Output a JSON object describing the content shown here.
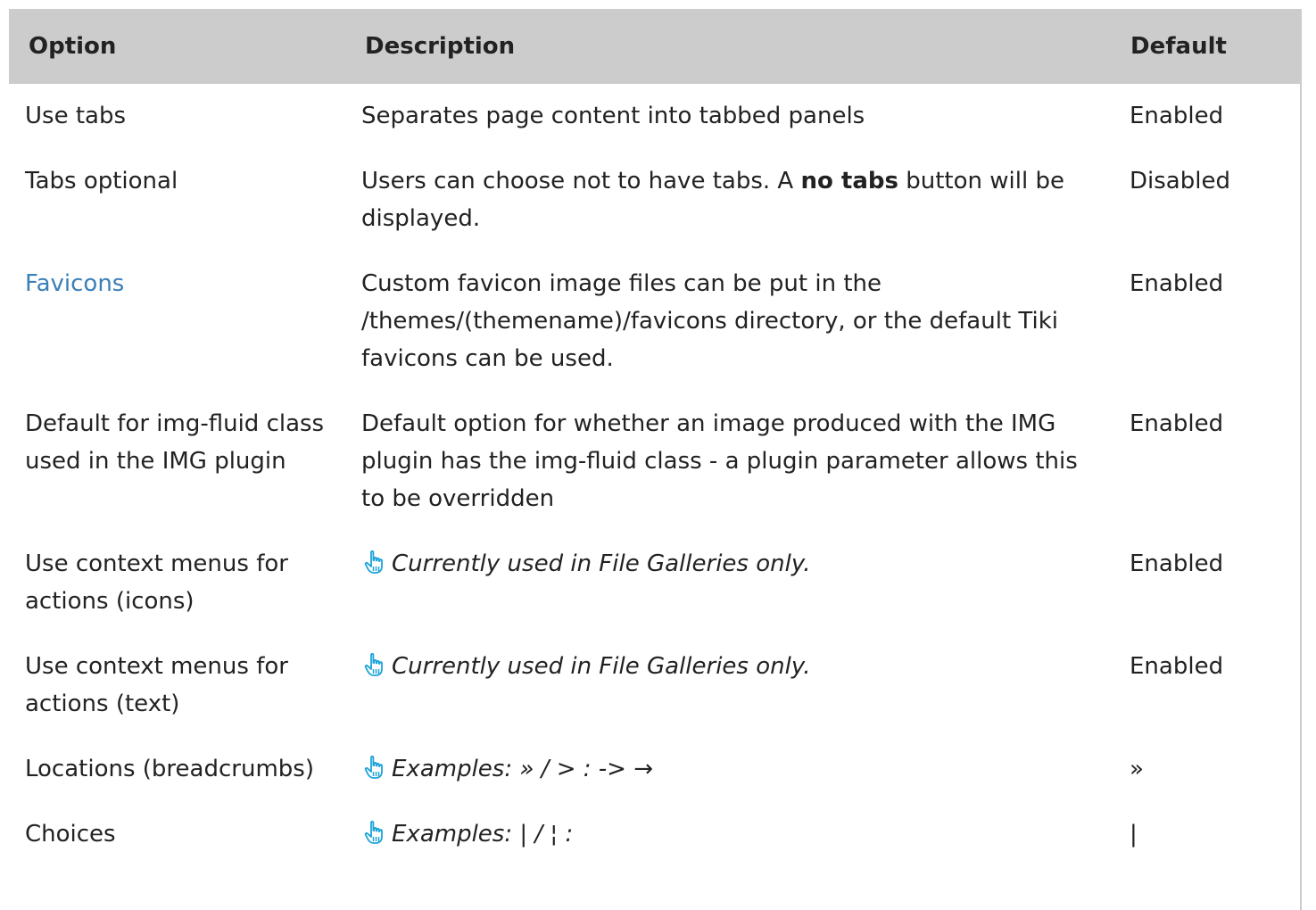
{
  "table": {
    "headers": {
      "option": "Option",
      "description": "Description",
      "default": "Default"
    },
    "rows": [
      {
        "option": "Use tabs",
        "description": "Separates page content into tabbed panels",
        "default": "Enabled"
      },
      {
        "option": "Tabs optional",
        "description_before": "Users can choose not to have tabs. A ",
        "description_bold": "no tabs",
        "description_after": " button will be displayed.",
        "default": "Disabled"
      },
      {
        "option": "Favicons",
        "option_is_link": true,
        "description": "Custom favicon image files can be put in the /themes/(themename)/favicons directory, or the default Tiki favicons can be used.",
        "default": "Enabled"
      },
      {
        "option": "Default for img-fluid class used in the IMG plugin",
        "description": "Default option for whether an image produced with the IMG plugin has the img-fluid class - a plugin parameter allows this to be overridden",
        "default": "Enabled"
      },
      {
        "option": "Use context menus for actions (icons)",
        "note_icon": "pointing-hand-icon",
        "description": "Currently used in File Galleries only.",
        "default": "Enabled"
      },
      {
        "option": "Use context menus for actions (text)",
        "note_icon": "pointing-hand-icon",
        "description": "Currently used in File Galleries only.",
        "default": "Enabled"
      },
      {
        "option": "Locations (breadcrumbs)",
        "note_icon": "pointing-hand-icon",
        "description": "Examples: » / > : -> →",
        "default": "»"
      },
      {
        "option": "Choices",
        "note_icon": "pointing-hand-icon",
        "description": "Examples: | / ¦ :",
        "default": "|"
      }
    ]
  },
  "colors": {
    "header_bg": "#cccccc",
    "link": "#3a7fb8",
    "icon": "#1ba3d8",
    "text": "#222222"
  }
}
